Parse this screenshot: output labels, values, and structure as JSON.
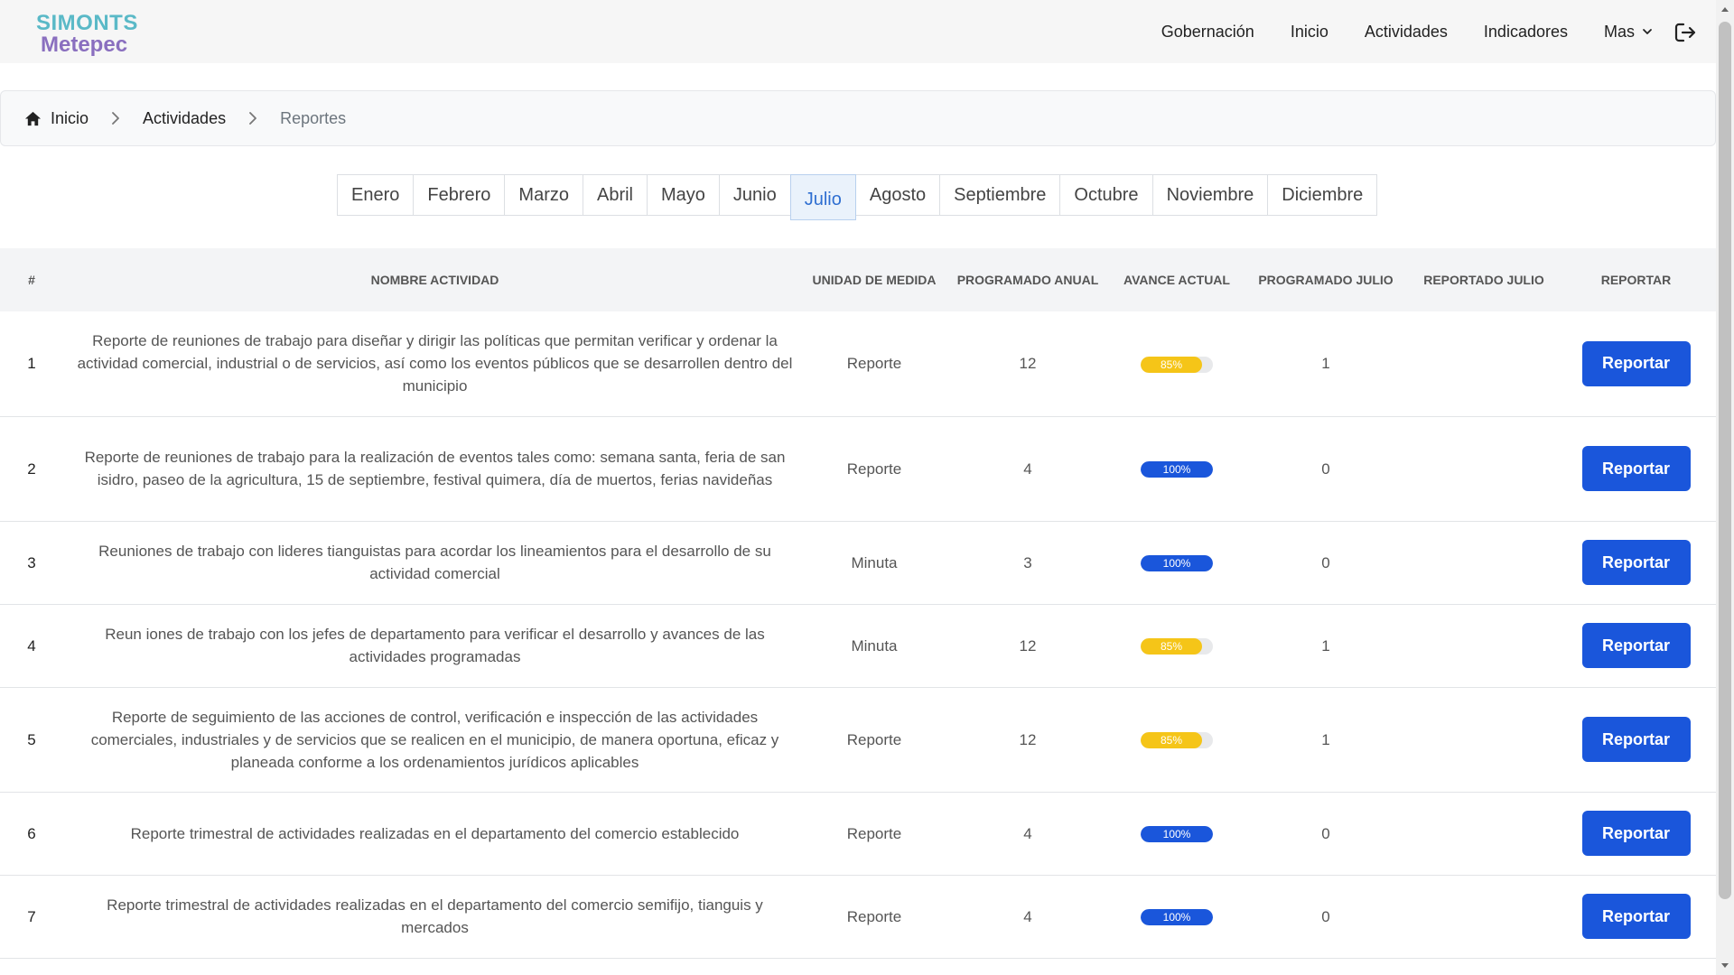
{
  "header": {
    "logo_line1": "SIMONTS",
    "logo_line2": "Metepec",
    "nav": [
      "Gobernación",
      "Inicio",
      "Actividades",
      "Indicadores"
    ],
    "more_label": "Mas",
    "icons": {
      "logout": "logout-icon",
      "more": "chevron-down-icon"
    }
  },
  "breadcrumb": {
    "items": [
      "Inicio",
      "Actividades",
      "Reportes"
    ],
    "icons": {
      "home": "home-icon",
      "separator": "chevron-right-icon"
    }
  },
  "months": {
    "items": [
      "Enero",
      "Febrero",
      "Marzo",
      "Abril",
      "Mayo",
      "Junio",
      "Julio",
      "Agosto",
      "Septiembre",
      "Octubre",
      "Noviembre",
      "Diciembre"
    ],
    "active": "Julio"
  },
  "table": {
    "headers": {
      "num": "#",
      "name": "NOMBRE ACTIVIDAD",
      "unit": "UNIDAD DE MEDIDA",
      "annual": "PROGRAMADO ANUAL",
      "progress": "AVANCE ACTUAL",
      "programmed_month": "PROGRAMADO JULIO",
      "reported_month": "REPORTADO JULIO",
      "action": "REPORTAR"
    },
    "button_label": "Reportar",
    "colors": {
      "progress_partial": "#f5c518",
      "progress_full": "#1a56db",
      "button": "#1a56db"
    },
    "rows": [
      {
        "num": "1",
        "name": "Reporte de reuniones de trabajo para diseñar y dirigir las políticas que permitan verificar y ordenar la actividad comercial, industrial o de servicios, así como los eventos públicos que se desarrollen dentro del municipio",
        "unit": "Reporte",
        "annual": "12",
        "progress": 85,
        "progress_label": "85%",
        "programmed": "1",
        "reported": ""
      },
      {
        "num": "2",
        "name": "Reporte de reuniones de trabajo para la realización de eventos tales como: semana santa, feria de san isidro, paseo de la agricultura, 15 de septiembre, festival quimera, día de muertos, ferias navideñas",
        "unit": "Reporte",
        "annual": "4",
        "progress": 100,
        "progress_label": "100%",
        "programmed": "0",
        "reported": ""
      },
      {
        "num": "3",
        "name": "Reuniones de trabajo con lideres tianguistas para acordar los lineamientos para el desarrollo de su actividad comercial",
        "unit": "Minuta",
        "annual": "3",
        "progress": 100,
        "progress_label": "100%",
        "programmed": "0",
        "reported": ""
      },
      {
        "num": "4",
        "name": "Reun iones de trabajo con los jefes de departamento para verificar el desarrollo y avances de las actividades programadas",
        "unit": "Minuta",
        "annual": "12",
        "progress": 85,
        "progress_label": "85%",
        "programmed": "1",
        "reported": ""
      },
      {
        "num": "5",
        "name": "Reporte de seguimiento de las acciones de control, verificación e inspección de las actividades comerciales, industriales y de servicios que se realicen en el municipio, de manera oportuna, eficaz y planeada conforme a los ordenamientos jurídicos aplicables",
        "unit": "Reporte",
        "annual": "12",
        "progress": 85,
        "progress_label": "85%",
        "programmed": "1",
        "reported": ""
      },
      {
        "num": "6",
        "name": "Reporte trimestral de actividades realizadas en el departamento del comercio establecido",
        "unit": "Reporte",
        "annual": "4",
        "progress": 100,
        "progress_label": "100%",
        "programmed": "0",
        "reported": ""
      },
      {
        "num": "7",
        "name": "Reporte trimestral de actividades realizadas en el departamento del comercio semifijo, tianguis y mercados",
        "unit": "Reporte",
        "annual": "4",
        "progress": 100,
        "progress_label": "100%",
        "programmed": "0",
        "reported": ""
      }
    ]
  }
}
